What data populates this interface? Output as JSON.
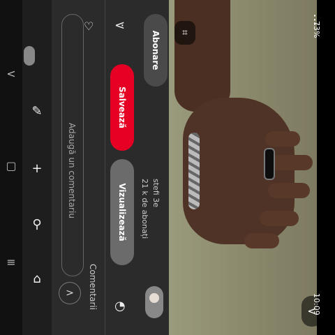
{
  "status_bar": {
    "time": "10:09",
    "battery": "73%"
  },
  "pin": {
    "author_name": "stefi 3e",
    "author_followers": "21 k de abonați",
    "follow_label": "Abonare",
    "visit_label": "Vizualizează",
    "save_label": "Salvează",
    "comments_label": "Comentarii",
    "comment_placeholder": "Adaugă un comentariu"
  },
  "colors": {
    "save_button": "#e60023",
    "visit_button": "#6b6b6b",
    "panel_bg": "#2b2b2b"
  },
  "icons": {
    "nav": [
      "home-icon",
      "search-icon",
      "add-icon",
      "chat-icon",
      "profile-icon"
    ],
    "system_nav": [
      "recents-icon",
      "home-circle-icon",
      "back-triangle-icon"
    ]
  }
}
